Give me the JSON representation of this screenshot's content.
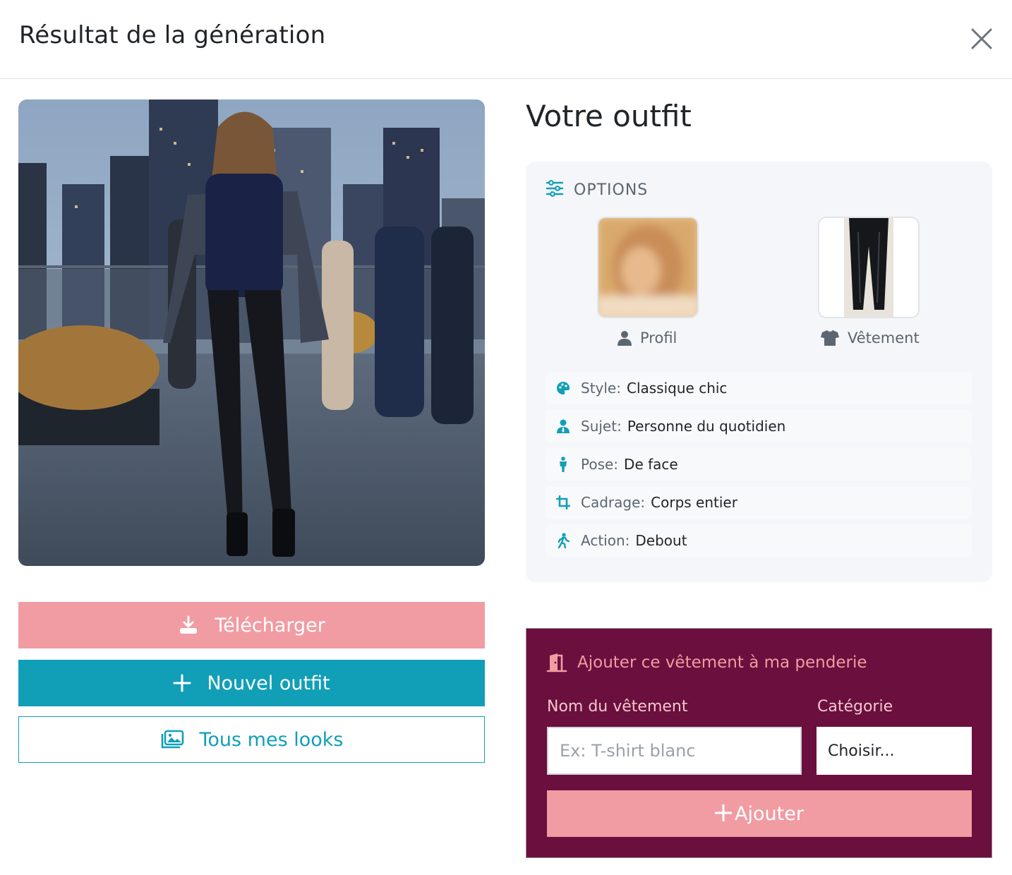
{
  "header": {
    "title": "Résultat de la génération",
    "close_icon": "close-icon"
  },
  "left": {
    "download_label": "Télécharger",
    "new_outfit_label": "Nouvel outfit",
    "all_looks_label": "Tous mes looks"
  },
  "right": {
    "outfit_title": "Votre outfit",
    "options_label": "OPTIONS",
    "profile_caption": "Profil",
    "garment_caption": "Vêtement",
    "options": [
      {
        "key": "Style:",
        "value": "Classique chic",
        "icon": "palette-icon"
      },
      {
        "key": "Sujet:",
        "value": "Personne du quotidien",
        "icon": "user-tie-icon"
      },
      {
        "key": "Pose:",
        "value": "De face",
        "icon": "person-icon"
      },
      {
        "key": "Cadrage:",
        "value": "Corps entier",
        "icon": "crop-icon"
      },
      {
        "key": "Action:",
        "value": "Debout",
        "icon": "walking-icon"
      }
    ]
  },
  "wardrobe": {
    "title": "Ajouter ce vêtement à ma penderie",
    "name_label": "Nom du vêtement",
    "name_placeholder": "Ex: T-shirt blanc",
    "name_value": "",
    "category_label": "Catégorie",
    "category_value": "Choisir...",
    "add_label": "Ajouter"
  },
  "colors": {
    "teal": "#119fb7",
    "pink": "#f19ca2",
    "wine": "#6a0f3e",
    "card_bg": "#f4f6f9"
  }
}
